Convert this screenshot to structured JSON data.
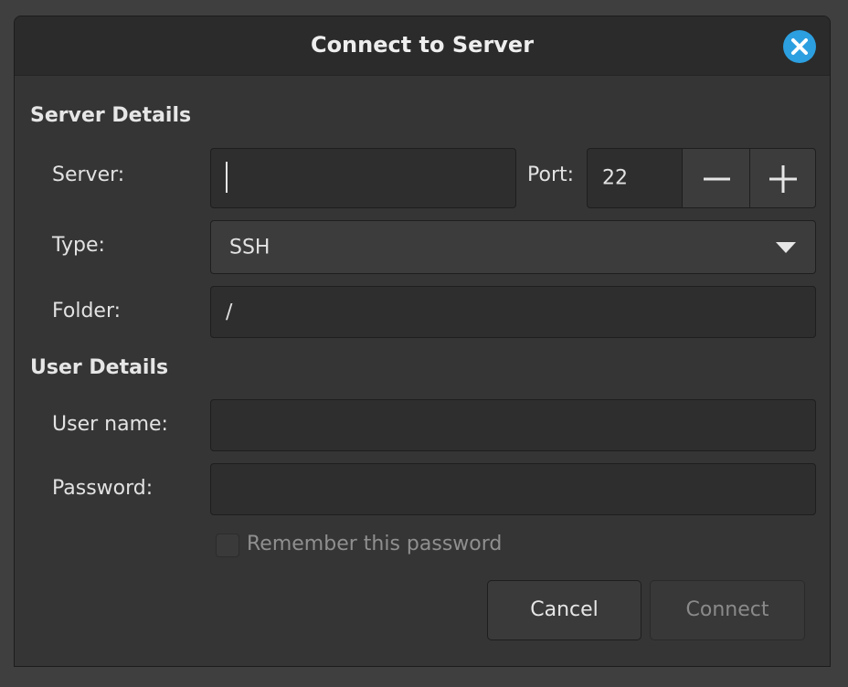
{
  "dialog": {
    "title": "Connect to Server"
  },
  "server_details": {
    "heading": "Server Details",
    "server_label": "Server:",
    "server_value": "",
    "port_label": "Port:",
    "port_value": "22",
    "type_label": "Type:",
    "type_value": "SSH",
    "folder_label": "Folder:",
    "folder_value": "/"
  },
  "user_details": {
    "heading": "User Details",
    "username_label": "User name:",
    "username_value": "",
    "password_label": "Password:",
    "password_value": "",
    "remember_label": "Remember this password",
    "remember_checked": false
  },
  "buttons": {
    "cancel_label": "Cancel",
    "connect_label": "Connect"
  },
  "colors": {
    "accent": "#2c9fe0",
    "background": "#353535",
    "titlebar": "#2b2b2b"
  },
  "icons": {
    "close": "close-icon",
    "decrement": "minus-icon",
    "increment": "plus-icon",
    "dropdown": "chevron-down-icon"
  }
}
